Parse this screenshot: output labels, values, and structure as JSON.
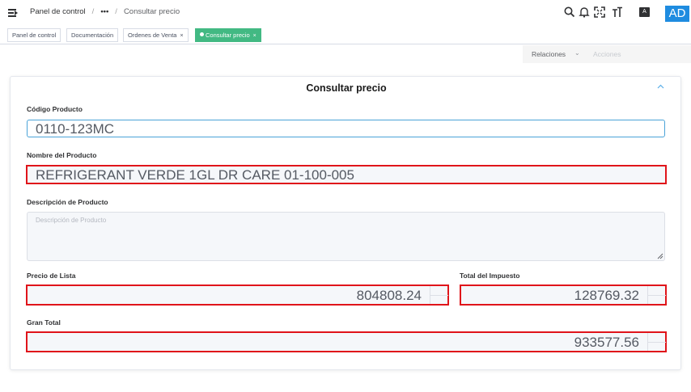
{
  "header": {
    "breadcrumb_home": "Panel de control",
    "breadcrumb_more": "•••",
    "breadcrumb_current": "Consultar precio",
    "user_initials": "AD",
    "lang_badge": "A"
  },
  "tabs": [
    {
      "label": "Panel de control",
      "closable": false,
      "active": false
    },
    {
      "label": "Documentación",
      "closable": false,
      "active": false
    },
    {
      "label": "Ordenes de Venta",
      "closable": true,
      "active": false
    },
    {
      "label": "Consultar precio",
      "closable": true,
      "active": true
    }
  ],
  "actions": {
    "relaciones": "Relaciones",
    "acciones": "Acciones"
  },
  "form": {
    "title": "Consultar precio",
    "codigo_label": "Código Producto",
    "codigo_value": "0110-123MC",
    "nombre_label": "Nombre del Producto",
    "nombre_value": "REFRIGERANT VERDE 1GL DR CARE 01-100-005",
    "descripcion_label": "Descripción de Producto",
    "descripcion_placeholder": "Descripción de Producto",
    "precio_label": "Precio de Lista",
    "precio_value": "804808.24",
    "impuesto_label": "Total del Impuesto",
    "impuesto_value": "128769.32",
    "gran_total_label": "Gran Total",
    "gran_total_value": "933577.56"
  },
  "colors": {
    "accent": "#1f8ce0",
    "active_tab": "#42b983",
    "error_border": "#e0141a"
  }
}
